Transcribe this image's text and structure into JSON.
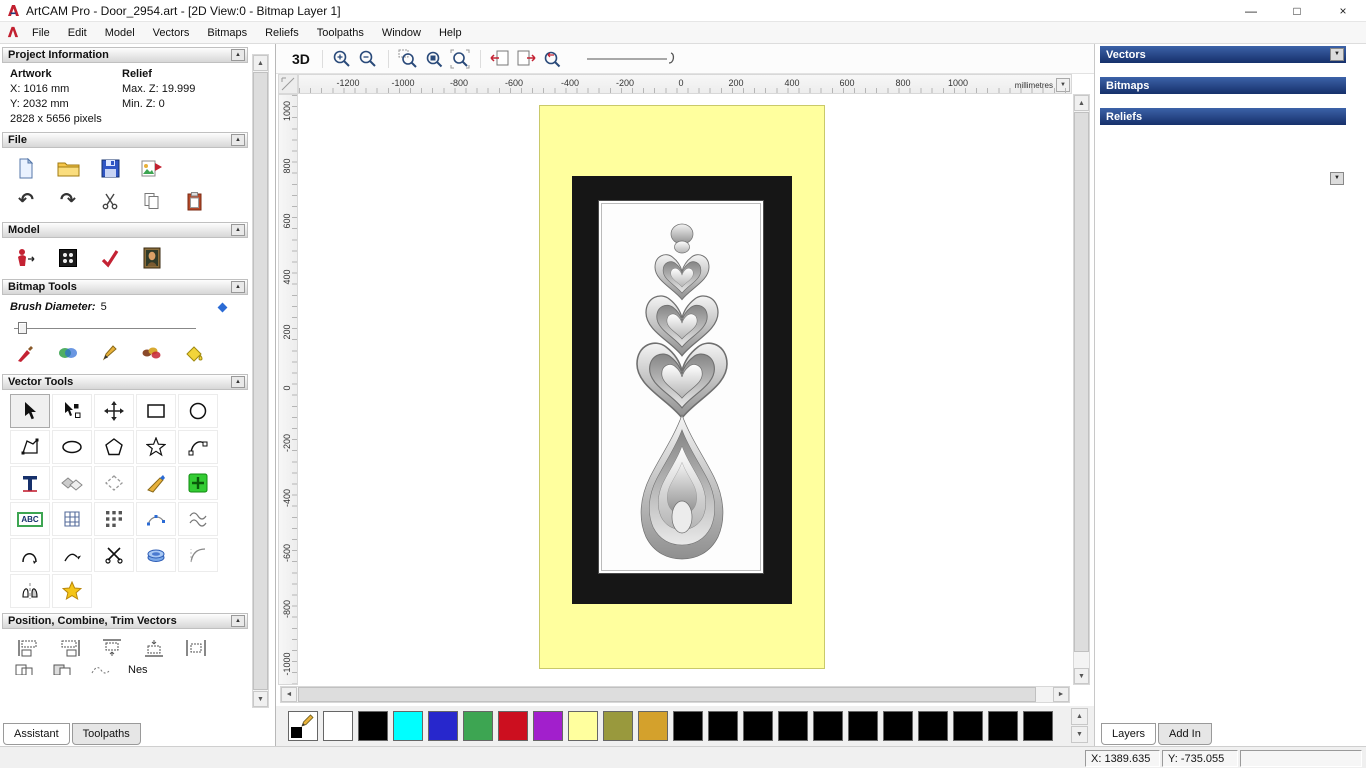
{
  "icons": {
    "minimize": "—",
    "maximize": "□",
    "close": "×",
    "up": "▲",
    "down": "▼",
    "left": "◄",
    "right": "►",
    "undo": "↶",
    "redo": "↷"
  },
  "titlebar": {
    "title": "ArtCAM Pro - Door_2954.art - [2D View:0 - Bitmap Layer 1]"
  },
  "menubar": {
    "items": [
      "File",
      "Edit",
      "Model",
      "Vectors",
      "Bitmaps",
      "Reliefs",
      "Toolpaths",
      "Window",
      "Help"
    ]
  },
  "toolbar": {
    "view3d": "3D"
  },
  "ruler": {
    "h": [
      "-1200",
      "-1000",
      "-800",
      "-600",
      "-400",
      "-200",
      "0",
      "200",
      "400",
      "600",
      "800",
      "1000"
    ],
    "v": [
      "1000",
      "800",
      "600",
      "400",
      "200",
      "0",
      "-200",
      "-400",
      "-600",
      "-800",
      "-1000"
    ],
    "units": "millimetres"
  },
  "assistant": {
    "project": {
      "header": "Project Information",
      "artwork_title": "Artwork",
      "artwork_x": "X: 1016 mm",
      "artwork_y": "Y: 2032 mm",
      "artwork_px": "2828 x 5656 pixels",
      "relief_title": "Relief",
      "relief_max": "Max. Z: 19.999",
      "relief_min": "Min. Z: 0"
    },
    "file_header": "File",
    "model_header": "Model",
    "bitmap_header": "Bitmap Tools",
    "brush_label": "Brush Diameter:",
    "brush_value": "5",
    "vector_header": "Vector Tools",
    "abc_label": "ABC",
    "position_header": "Position, Combine, Trim Vectors",
    "nesting_label": "Nes",
    "tabs": [
      "Assistant",
      "Toolpaths"
    ]
  },
  "right_panel": {
    "vectors_header": "Vectors",
    "bitmaps_header": "Bitmaps",
    "reliefs_header": "Reliefs",
    "tabs": [
      "Layers",
      "Add In"
    ]
  },
  "statusbar": {
    "x": "X: 1389.635",
    "y": "Y: -735.055"
  },
  "palette": {
    "colors": [
      "#ffffff",
      "#000000",
      "#00ffff",
      "#2727cc",
      "#3da552",
      "#cc0f1f",
      "#a21fcc",
      "#ffff9e",
      "#99993d",
      "#d4a12c",
      "#000000",
      "#000000",
      "#000000",
      "#000000",
      "#000000",
      "#000000",
      "#000000",
      "#000000",
      "#000000",
      "#000000",
      "#000000"
    ]
  },
  "colors": {
    "artwork_yellow": "#ffff9e",
    "header_blue": "#16306b"
  }
}
